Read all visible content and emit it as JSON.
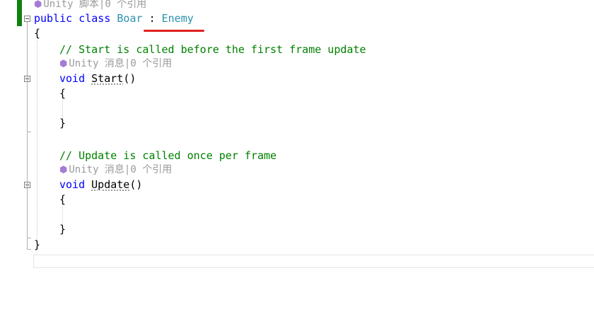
{
  "code": {
    "class_hint": "Unity 脚本|0 个引用",
    "class_kw1": "public",
    "class_kw2": "class",
    "class_name": "Boar",
    "colon": ":",
    "base_class": "Enemy",
    "open_brace": "{",
    "comment_start": "// Start is called before the first frame update",
    "start_hint": "Unity 消息|0 个引用",
    "void1": "void",
    "method_start": "Start",
    "parens1": "()",
    "brace_open1": "{",
    "brace_close1": "}",
    "comment_update": "// Update is called once per frame",
    "update_hint": "Unity 消息|0 个引用",
    "void2": "void",
    "method_update": "Update",
    "parens2": "()",
    "brace_open2": "{",
    "brace_close2": "}",
    "close_brace": "}"
  },
  "colors": {
    "keyword": "#0000ff",
    "type": "#2b91af",
    "comment": "#008000",
    "hint": "#9a9a9a",
    "annotation_underline": "#e02020",
    "changed_bar": "#108010"
  },
  "icons": {
    "codelens": "unity-cube-icon",
    "fold": "collapse-minus-icon"
  }
}
